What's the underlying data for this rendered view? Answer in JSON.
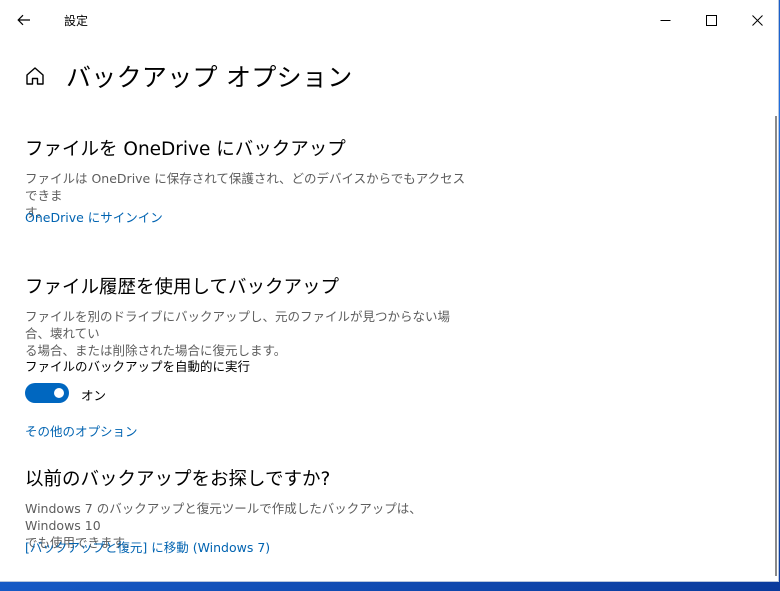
{
  "window": {
    "app_title": "設定",
    "page_title": "バックアップ オプション"
  },
  "onedrive": {
    "heading": "ファイルを OneDrive にバックアップ",
    "desc_line1": "ファイルは OneDrive に保存されて保護され、どのデバイスからでもアクセスできま",
    "desc_line2": "す。",
    "link": "OneDrive にサインイン"
  },
  "file_history": {
    "heading": "ファイル履歴を使用してバックアップ",
    "desc_line1": "ファイルを別のドライブにバックアップし、元のファイルが見つからない場合、壊れてい",
    "desc_line2": "る場合、または削除された場合に復元します。",
    "auto_label": "ファイルのバックアップを自動的に実行",
    "toggle_state": "オン",
    "toggle_on": true,
    "more_options_link": "その他のオプション"
  },
  "older_backup": {
    "heading": "以前のバックアップをお探しですか?",
    "desc_line1": "Windows 7 のバックアップと復元ツールで作成したバックアップは、Windows 10",
    "desc_line2": "でも使用できます。",
    "link": "[バックアップと復元] に移動 (Windows 7)"
  },
  "colors": {
    "accent": "#0067c0",
    "link": "#0063b1",
    "secondary_text": "#5d5d5d"
  },
  "icons": [
    "back-arrow-icon",
    "minimize-icon",
    "maximize-icon",
    "close-icon",
    "home-icon"
  ]
}
